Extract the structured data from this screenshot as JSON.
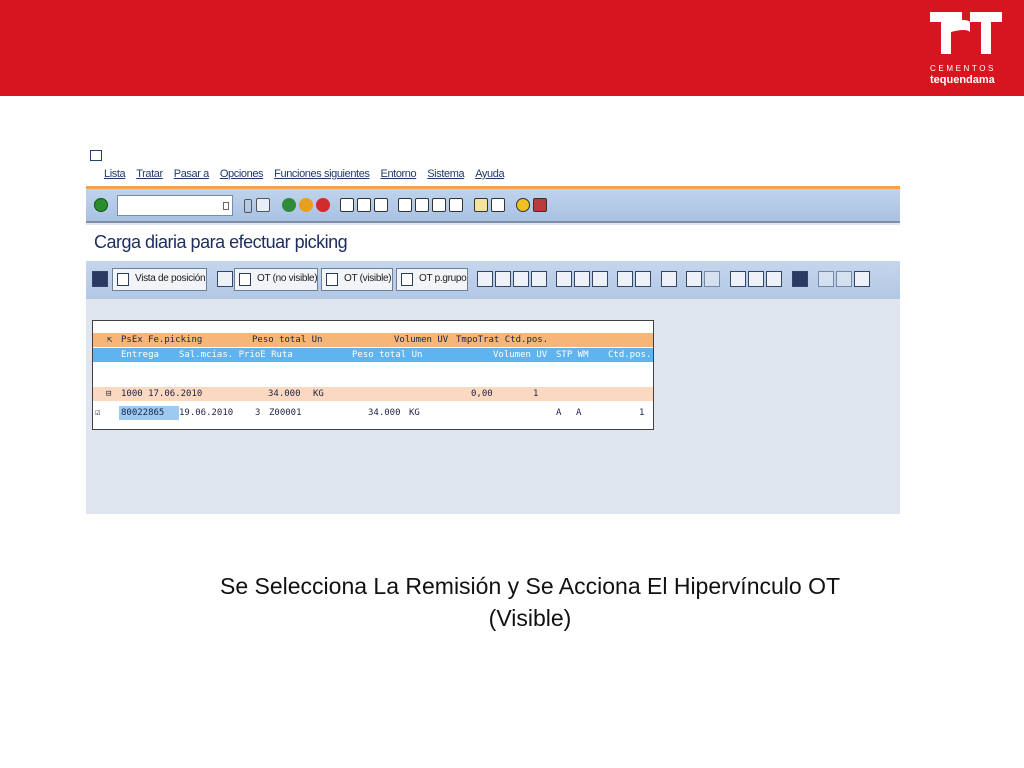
{
  "brand": {
    "small": "CEMENTOS",
    "name": "tequendama"
  },
  "menu": [
    "Lista",
    "Tratar",
    "Pasar a",
    "Opciones",
    "Funciones siguientes",
    "Entorno",
    "Sistema",
    "Ayuda"
  ],
  "page_title": "Carga diaria para efectuar picking",
  "toolbar": {
    "vista_posicion": "Vista de posición",
    "ot_no_visible": "OT (no visible)",
    "ot_visible": "OT (visible)",
    "ot_grupo": "OT p.grupo"
  },
  "grid": {
    "header1": {
      "c1": "PsEx Fe.picking",
      "c2": "Peso total Un",
      "c3": "Volumen UV",
      "c4": "TmpoTrat Ctd.pos."
    },
    "header2": {
      "c1": "Entrega",
      "c2": "Sal.mcías. PrioE Ruta",
      "c3": "Peso total Un",
      "c4": "Volumen UV",
      "c5": "STP WM",
      "c6": "Ctd.pos."
    },
    "row1": {
      "date": "1000 17.06.2010",
      "peso": "34.000",
      "un": "KG",
      "vol": "0,00",
      "ctd": "1"
    },
    "row2": {
      "entrega": "80022865",
      "fecha": "19.06.2010",
      "prio": "3",
      "ruta": "Z00001",
      "peso": "34.000",
      "un": "KG",
      "stp": "A",
      "wm": "A",
      "ctd": "1"
    }
  },
  "caption": {
    "line1": "Se Selecciona  La Remisión  y Se Acciona  El Hipervínculo OT",
    "line2": "(Visible)"
  },
  "colors": {
    "header_red": "#d7151e",
    "title_blue": "#1d2f60",
    "row_orange": "#f7b677",
    "row_blue": "#5fb3ef"
  }
}
